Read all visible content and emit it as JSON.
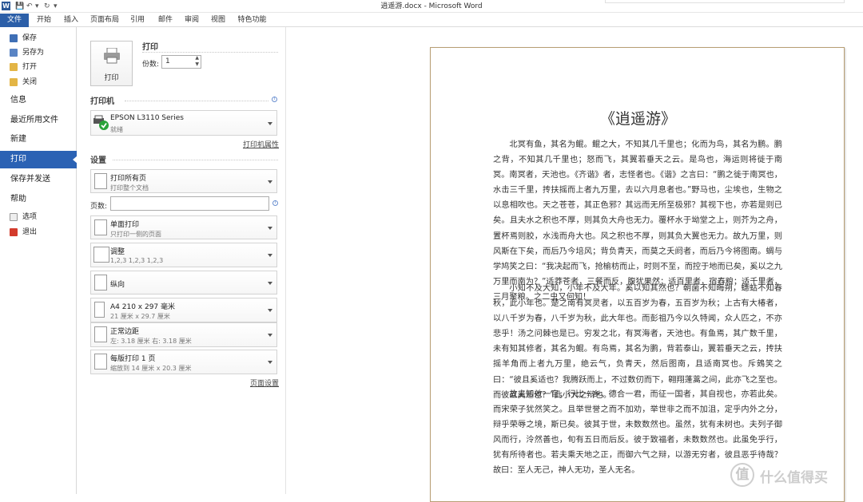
{
  "window": {
    "title": "逍遥游.docx - Microsoft Word"
  },
  "ribbon_tabs": [
    "文件",
    "开始",
    "插入",
    "页面布局",
    "引用",
    "邮件",
    "审阅",
    "视图",
    "特色功能"
  ],
  "backstage_nav": {
    "small_top": [
      "保存",
      "另存为",
      "打开",
      "关闭"
    ],
    "big": [
      "信息",
      "最近所用文件",
      "新建",
      "打印",
      "保存并发送",
      "帮助"
    ],
    "selected": "打印",
    "small_bottom": [
      "选项",
      "退出"
    ]
  },
  "print": {
    "header": "打印",
    "button": "打印",
    "copies_label": "份数:",
    "copies_value": "1",
    "printer_header": "打印机",
    "printer_name": "EPSON L3110 Series",
    "printer_status": "就绪",
    "printer_props": "打印机属性",
    "settings_header": "设置",
    "pages_label": "页数:",
    "settings": [
      {
        "title": "打印所有页",
        "sub": "打印整个文档"
      },
      {
        "title": "单面打印",
        "sub": "只打印一侧的页面"
      },
      {
        "title": "调整",
        "sub": "1,2,3    1,2,3    1,2,3"
      },
      {
        "title": "纵向",
        "sub": ""
      },
      {
        "title": "A4 210 x 297 毫米",
        "sub": "21 厘米 x 29.7 厘米"
      },
      {
        "title": "正常边距",
        "sub": "左: 3.18 厘米    右: 3.18 厘米"
      },
      {
        "title": "每版打印 1 页",
        "sub": "缩放到 14 厘米 x 20.3 厘米"
      }
    ],
    "page_setup": "页面设置"
  },
  "document": {
    "title": "《逍遥游》",
    "paragraphs": [
      "北冥有鱼，其名为鲲。鲲之大，不知其几千里也；化而为鸟，其名为鹏。鹏之背，不知其几千里也；怒而飞，其翼若垂天之云。是鸟也，海运则将徙于南冥。南冥者，天池也。《齐谐》者，志怪者也。《谐》之言曰：“鹏之徙于南冥也，水击三千里，抟扶摇而上者九万里，去以六月息者也。”野马也，尘埃也，生物之以息相吹也。天之苍苍，其正色邪？其远而无所至极邪？其视下也，亦若是则已矣。且夫水之积也不厚，则其负大舟也无力。覆杯水于坳堂之上，则芥为之舟，置杯焉则胶，水浅而舟大也。风之积也不厚，则其负大翼也无力。故九万里，则风斯在下矣，而后乃今培风；背负青天，而莫之夭阏者，而后乃今将图南。蜩与学鸠笑之曰：“我决起而飞，抢榆枋而止，时则不至，而控于地而已矣，奚以之九万里而南为？”适莽苍者，三餐而反，腹犹果然；适百里者，宿舂粮；适千里者，三月聚粮。之二虫又何知！",
      "小知不及大知，小年不及大年。奚以知其然也？朝菌不知晦朔，蟪蛄不知春秋，此小年也。楚之南有冥灵者，以五百岁为春，五百岁为秋；上古有大椿者，以八千岁为春，八千岁为秋，此大年也。而彭祖乃今以久特闻，众人匹之，不亦悲乎！汤之问棘也是已。穷发之北，有冥海者，天池也。有鱼焉，其广数千里，未有知其修者，其名为鲲。有鸟焉，其名为鹏，背若泰山，翼若垂天之云，抟扶摇羊角而上者九万里，绝云气，负青天，然后图南，且适南冥也。斥鴳笑之曰：“彼且奚适也？我腾跃而上，不过数仞而下，翱翔蓬蒿之间，此亦飞之至也。而彼且奚适也？”此小大之辩也。",
      "故夫知效一官，行比一乡，德合一君，而征一国者，其自视也，亦若此矣。而宋荣子犹然笑之。且举世誉之而不加劝，举世非之而不加沮，定乎内外之分，辩乎荣辱之境，斯已矣。彼其于世，未数数然也。虽然，犹有未树也。夫列子御风而行，泠然善也，旬有五日而后反。彼于致福者，未数数然也。此虽免乎行，犹有所待者也。若夫乘天地之正，而御六气之辩，以游无穷者，彼且恶乎待哉？故曰：至人无己，神人无功，圣人无名。"
    ]
  },
  "watermark": {
    "badge": "值",
    "text": "什么值得买"
  }
}
